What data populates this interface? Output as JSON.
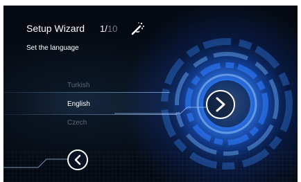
{
  "header": {
    "title": "Setup Wizard",
    "step_current": "1",
    "step_separator": "/",
    "step_total": "10",
    "icon": "magic-wand-icon"
  },
  "subtitle": "Set the language",
  "languages": [
    {
      "label": "Turkish",
      "selected": false
    },
    {
      "label": "English",
      "selected": true
    },
    {
      "label": "Czech",
      "selected": false
    }
  ],
  "nav": {
    "next_icon": "chevron-right-icon",
    "back_icon": "chevron-left-icon"
  },
  "colors": {
    "accent": "#2f7dff",
    "text": "#ffffff",
    "dim_text": "#5c6773",
    "background": "#04070c"
  }
}
